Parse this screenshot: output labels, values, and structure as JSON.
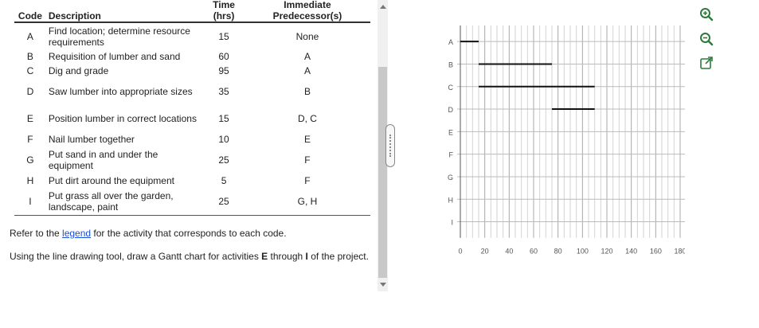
{
  "table": {
    "headers": {
      "code": "Code",
      "description": "Description",
      "time_line1": "Time",
      "time_line2": "(hrs)",
      "pred_line1": "Immediate",
      "pred_line2": "Predecessor(s)"
    },
    "rows": [
      {
        "code": "A",
        "description": "Find location; determine resource requirements",
        "time": "15",
        "predecessors": "None"
      },
      {
        "code": "B",
        "description": "Requisition of lumber and sand",
        "time": "60",
        "predecessors": "A"
      },
      {
        "code": "C",
        "description": "Dig and grade",
        "time": "95",
        "predecessors": "A"
      },
      {
        "code": "D",
        "description": "Saw lumber into appropriate sizes",
        "time": "35",
        "predecessors": "B"
      },
      {
        "code": "E",
        "description": "Position lumber in correct locations",
        "time": "15",
        "predecessors": "D, C"
      },
      {
        "code": "F",
        "description": "Nail lumber together",
        "time": "10",
        "predecessors": "E"
      },
      {
        "code": "G",
        "description": "Put sand in and under the equipment",
        "time": "25",
        "predecessors": "F"
      },
      {
        "code": "H",
        "description": "Put dirt around the equipment",
        "time": "5",
        "predecessors": "F"
      },
      {
        "code": "I",
        "description": "Put grass all over the garden, landscape, paint",
        "time": "25",
        "predecessors": "G, H"
      }
    ]
  },
  "instructions": {
    "refer_prefix": "Refer to the ",
    "legend_link": "legend",
    "refer_suffix": " for the activity that corresponds to each code.",
    "task_prefix": "Using the line drawing tool, draw a Gantt chart for activities ",
    "task_from": "E",
    "task_middle": " through ",
    "task_to": "I",
    "task_suffix": " of the project."
  },
  "chart_data": {
    "type": "gantt",
    "categories": [
      "A",
      "B",
      "C",
      "D",
      "E",
      "F",
      "G",
      "H",
      "I"
    ],
    "x_ticks": [
      "0",
      "20",
      "40",
      "60",
      "80",
      "100",
      "120",
      "140",
      "160",
      "180"
    ],
    "xlim": [
      0,
      180
    ],
    "grid": true,
    "bars": [
      {
        "task": "A",
        "start": 0,
        "end": 15
      },
      {
        "task": "B",
        "start": 15,
        "end": 75
      },
      {
        "task": "C",
        "start": 15,
        "end": 110
      },
      {
        "task": "D",
        "start": 75,
        "end": 110
      }
    ]
  },
  "toolbar": {
    "icons": [
      "zoom-in-icon",
      "zoom-out-icon",
      "expand-icon"
    ],
    "color": "#2d7a3a"
  },
  "colors": {
    "link": "#1a4ed8",
    "grid": "#bbbbbb",
    "bar": "#111111"
  }
}
